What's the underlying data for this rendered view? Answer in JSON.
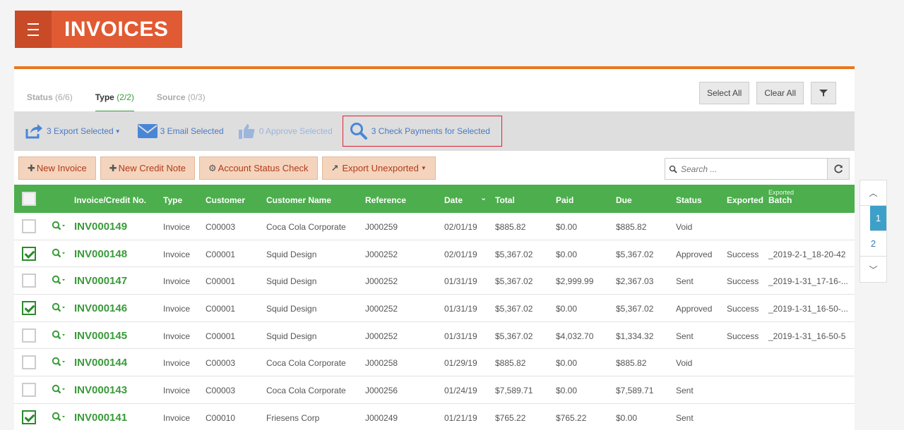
{
  "header": {
    "title": "INVOICES"
  },
  "filter_tabs": [
    {
      "label": "Status",
      "count": "(6/6)"
    },
    {
      "label": "Type",
      "count": "(2/2)"
    },
    {
      "label": "Source",
      "count": "(0/3)"
    }
  ],
  "top_buttons": {
    "select_all": "Select All",
    "clear_all": "Clear All"
  },
  "actions": {
    "export": "3 Export Selected",
    "email": "3 Email Selected",
    "approve": "0 Approve Selected",
    "check_payments": "3 Check Payments for Selected"
  },
  "buttons": {
    "new_invoice": "New Invoice",
    "new_credit_note": "New Credit Note",
    "account_status": "Account Status Check",
    "export_unexported": "Export Unexported"
  },
  "search": {
    "placeholder": "Search ..."
  },
  "table": {
    "headers": {
      "invoice_no": "Invoice/Credit No.",
      "type": "Type",
      "customer": "Customer",
      "customer_name": "Customer Name",
      "reference": "Reference",
      "date": "Date",
      "total": "Total",
      "paid": "Paid",
      "due": "Due",
      "status": "Status",
      "exported": "Exported",
      "batch_small": "Exported",
      "batch": "Batch"
    },
    "rows": [
      {
        "checked": false,
        "no": "INV000149",
        "type": "Invoice",
        "customer": "C00003",
        "name": "Coca Cola Corporate",
        "ref": "J000259",
        "date": "02/01/19",
        "total": "$885.82",
        "paid": "$0.00",
        "due": "$885.82",
        "status": "Void",
        "exported": "",
        "batch": ""
      },
      {
        "checked": true,
        "no": "INV000148",
        "type": "Invoice",
        "customer": "C00001",
        "name": "Squid Design",
        "ref": "J000252",
        "date": "02/01/19",
        "total": "$5,367.02",
        "paid": "$0.00",
        "due": "$5,367.02",
        "status": "Approved",
        "exported": "Success",
        "batch": "_2019-2-1_18-20-42"
      },
      {
        "checked": false,
        "no": "INV000147",
        "type": "Invoice",
        "customer": "C00001",
        "name": "Squid Design",
        "ref": "J000252",
        "date": "01/31/19",
        "total": "$5,367.02",
        "paid": "$2,999.99",
        "due": "$2,367.03",
        "status": "Sent",
        "exported": "Success",
        "batch": "_2019-1-31_17-16-..."
      },
      {
        "checked": true,
        "no": "INV000146",
        "type": "Invoice",
        "customer": "C00001",
        "name": "Squid Design",
        "ref": "J000252",
        "date": "01/31/19",
        "total": "$5,367.02",
        "paid": "$0.00",
        "due": "$5,367.02",
        "status": "Approved",
        "exported": "Success",
        "batch": "_2019-1-31_16-50-..."
      },
      {
        "checked": false,
        "no": "INV000145",
        "type": "Invoice",
        "customer": "C00001",
        "name": "Squid Design",
        "ref": "J000252",
        "date": "01/31/19",
        "total": "$5,367.02",
        "paid": "$4,032.70",
        "due": "$1,334.32",
        "status": "Sent",
        "exported": "Success",
        "batch": "_2019-1-31_16-50-5"
      },
      {
        "checked": false,
        "no": "INV000144",
        "type": "Invoice",
        "customer": "C00003",
        "name": "Coca Cola Corporate",
        "ref": "J000258",
        "date": "01/29/19",
        "total": "$885.82",
        "paid": "$0.00",
        "due": "$885.82",
        "status": "Void",
        "exported": "",
        "batch": ""
      },
      {
        "checked": false,
        "no": "INV000143",
        "type": "Invoice",
        "customer": "C00003",
        "name": "Coca Cola Corporate",
        "ref": "J000256",
        "date": "01/24/19",
        "total": "$7,589.71",
        "paid": "$0.00",
        "due": "$7,589.71",
        "status": "Sent",
        "exported": "",
        "batch": ""
      },
      {
        "checked": true,
        "no": "INV000141",
        "type": "Invoice",
        "customer": "C00010",
        "name": "Friesens Corp",
        "ref": "J000249",
        "date": "01/21/19",
        "total": "$765.22",
        "paid": "$765.22",
        "due": "$0.00",
        "status": "Sent",
        "exported": "",
        "batch": ""
      }
    ]
  },
  "pager": {
    "pages": [
      "1",
      "2"
    ],
    "current": "1"
  },
  "colors": {
    "brand": "#e05a33",
    "accent": "#e87722",
    "table_header": "#4cae4c",
    "link": "#3a9a3a"
  }
}
